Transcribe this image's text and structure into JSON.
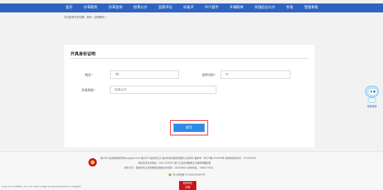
{
  "nav": {
    "items": [
      "首页",
      "办事服务",
      "办事咨询",
      "结果公示",
      "监督评议",
      "好差评",
      "中介超市",
      "乡镇联审",
      "单独后台公示",
      "秒批",
      "智能审批"
    ],
    "background": "#2f63c0"
  },
  "breadcrumb": {
    "text": "您当前所在的位置：首页 > 证明服务 >"
  },
  "card": {
    "title": "开具身份证明"
  },
  "form": {
    "name_label": "姓名",
    "name_value": "*四",
    "id_label": "证件号码",
    "id_value": "*5",
    "purpose_label": "开具用途",
    "purpose_value": "信息公开",
    "required_mark": "*"
  },
  "submit": {
    "label": "提交",
    "color": "#2f8be6",
    "highlight_color": "#ee2222"
  },
  "footer": {
    "line1": "德州市人民政府版权所有copyright 2016  德州市人民政府主办  德州市政务服务管理办公室承办  备案号：鲁ICP备17049998号  政府网站标识码：3714000053",
    "line2": "网站技术支持电话：0534-2236757    部门公告查询截屏五日维修提醒处理",
    "line3": "联系方式：德政所在业务受理相关疑难请来咨询：2383099823  咨询电话：19863770981",
    "line4": "鲁公网安备 37140202000437号",
    "badge_line1": "政府网站",
    "badge_line2": "找错"
  },
  "status_bar": {
    "text": "rrows are available, you can resize image by pressing button to navigate"
  },
  "assistant": {
    "label": "智能客服"
  }
}
